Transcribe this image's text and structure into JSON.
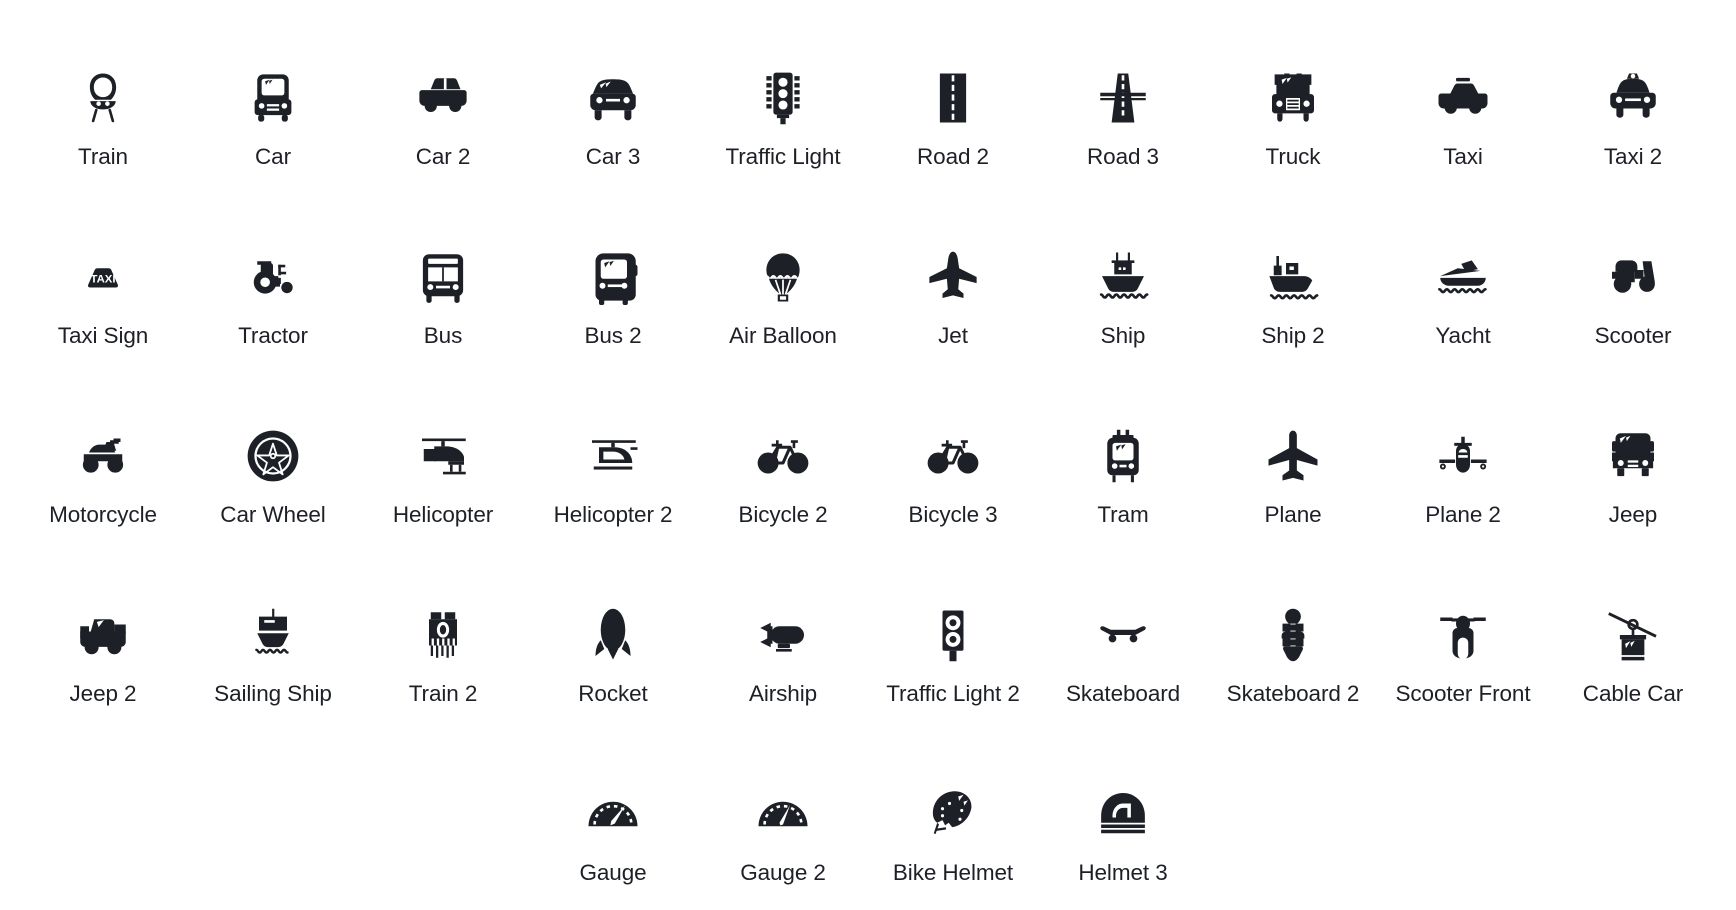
{
  "gallery": {
    "columns": 10,
    "text_color": "#1d2026",
    "background_color": "#ffffff",
    "rows": [
      {
        "items": [
          {
            "label": "Train",
            "icon": "train-icon"
          },
          {
            "label": "Car",
            "icon": "car-icon"
          },
          {
            "label": "Car 2",
            "icon": "car-2-icon"
          },
          {
            "label": "Car 3",
            "icon": "car-3-icon"
          },
          {
            "label": "Traffic Light",
            "icon": "traffic-light-icon"
          },
          {
            "label": "Road 2",
            "icon": "road-2-icon"
          },
          {
            "label": "Road 3",
            "icon": "road-3-icon"
          },
          {
            "label": "Truck",
            "icon": "truck-icon"
          },
          {
            "label": "Taxi",
            "icon": "taxi-icon"
          },
          {
            "label": "Taxi 2",
            "icon": "taxi-2-icon"
          }
        ]
      },
      {
        "items": [
          {
            "label": "Taxi Sign",
            "icon": "taxi-sign-icon"
          },
          {
            "label": "Tractor",
            "icon": "tractor-icon"
          },
          {
            "label": "Bus",
            "icon": "bus-icon"
          },
          {
            "label": "Bus 2",
            "icon": "bus-2-icon"
          },
          {
            "label": "Air Balloon",
            "icon": "air-balloon-icon"
          },
          {
            "label": "Jet",
            "icon": "jet-icon"
          },
          {
            "label": "Ship",
            "icon": "ship-icon"
          },
          {
            "label": "Ship 2",
            "icon": "ship-2-icon"
          },
          {
            "label": "Yacht",
            "icon": "yacht-icon"
          },
          {
            "label": "Scooter",
            "icon": "scooter-icon"
          }
        ]
      },
      {
        "items": [
          {
            "label": "Motorcycle",
            "icon": "motorcycle-icon"
          },
          {
            "label": "Car Wheel",
            "icon": "car-wheel-icon"
          },
          {
            "label": "Helicopter",
            "icon": "helicopter-icon"
          },
          {
            "label": "Helicopter 2",
            "icon": "helicopter-2-icon"
          },
          {
            "label": "Bicycle 2",
            "icon": "bicycle-2-icon"
          },
          {
            "label": "Bicycle 3",
            "icon": "bicycle-3-icon"
          },
          {
            "label": "Tram",
            "icon": "tram-icon"
          },
          {
            "label": "Plane",
            "icon": "plane-icon"
          },
          {
            "label": "Plane 2",
            "icon": "plane-2-icon"
          },
          {
            "label": "Jeep",
            "icon": "jeep-icon"
          }
        ]
      },
      {
        "items": [
          {
            "label": "Jeep 2",
            "icon": "jeep-2-icon"
          },
          {
            "label": "Sailing Ship",
            "icon": "sailing-ship-icon"
          },
          {
            "label": "Train 2",
            "icon": "train-2-icon"
          },
          {
            "label": "Rocket",
            "icon": "rocket-icon"
          },
          {
            "label": "Airship",
            "icon": "airship-icon"
          },
          {
            "label": "Traffic Light 2",
            "icon": "traffic-light-2-icon"
          },
          {
            "label": "Skateboard",
            "icon": "skateboard-icon"
          },
          {
            "label": "Skateboard 2",
            "icon": "skateboard-2-icon"
          },
          {
            "label": "Scooter Front",
            "icon": "scooter-front-icon"
          },
          {
            "label": "Cable Car",
            "icon": "cable-car-icon"
          }
        ]
      },
      {
        "items": [
          {
            "label": "",
            "icon": ""
          },
          {
            "label": "",
            "icon": ""
          },
          {
            "label": "",
            "icon": ""
          },
          {
            "label": "Gauge",
            "icon": "gauge-icon"
          },
          {
            "label": "Gauge 2",
            "icon": "gauge-2-icon"
          },
          {
            "label": "Bike Helmet",
            "icon": "bike-helmet-icon"
          },
          {
            "label": "Helmet 3",
            "icon": "helmet-3-icon"
          },
          {
            "label": "",
            "icon": ""
          },
          {
            "label": "",
            "icon": ""
          },
          {
            "label": "",
            "icon": ""
          }
        ]
      }
    ]
  }
}
